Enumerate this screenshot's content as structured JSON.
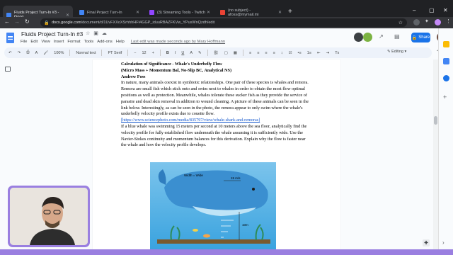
{
  "browser": {
    "tabs": [
      {
        "title": "Fluids Project Turn-In #3 - Goog",
        "favicon_color": "#4285f4",
        "active": true
      },
      {
        "title": "Final Project Turn-In",
        "favicon_color": "#4285f4",
        "active": false
      },
      {
        "title": "(3) Streaming Tools - Twitch",
        "favicon_color": "#9146ff",
        "active": false
      },
      {
        "title": "(no subject) - afoss@mymail.mi",
        "favicon_color": "#ea4335",
        "active": false
      }
    ],
    "new_tab_glyph": "+",
    "window_controls": [
      "–",
      "▢",
      "✕"
    ],
    "url_host": "docs.google.com",
    "url_path": "/document/d/1UvFXXoXSrhhhHFt4GGP_iduuRBAZFKVw_YPuxWnQzdh/edit"
  },
  "docs": {
    "title": "Fluids Project Turn-In #3",
    "menu": [
      "File",
      "Edit",
      "View",
      "Insert",
      "Format",
      "Tools",
      "Add-ons",
      "Help"
    ],
    "last_edit": "Last edit was made seconds ago by Mary Hoffmann",
    "share_label": "Share",
    "toolbar": {
      "zoom": "100%",
      "style": "Normal text",
      "font": "PT Serif",
      "size": "12",
      "mode": "Editing"
    }
  },
  "document": {
    "heading1": "Calculation of Significance - Whale's Underbelly Flow",
    "heading2": "(Micro Mass + Momentum Bal, No-Slip BC, Analytical NS)",
    "author": "Andrew Foss",
    "paragraph1": "In nature, many animals coexist in symbiotic relationships. One pair of these species is whales and remora. Remora are small fish which stick onto and swim next to whales in order to obtain the most flow optimal positions as well as protection. Meanwhile, whales tolerate these sucker fish as they provide the service of parasite and dead skin removal in addition to wound cleaning. A picture of these animals can be seen in the link below. Interestingly, as can be seen in the photo, the remora appear to only swim where the whale's underbelly velocity profile exists due to couette flow.",
    "link": "[https://www.sciencephoto.com/media/835797/view/whale-shark-and-remoras]",
    "paragraph2": "If a blue whale was swimming 15 meters per second at 10 meters above the sea floor, analytically find the velocity profile for fully established flow underneath the whale assuming it is sufficiently wide. Use the Navier-Stokes continuity and momentum balances for this derivation. Explain why the flow is faster near the whale and how the velocity profile develops.",
    "figure_labels": {
      "width": "Width = Wide",
      "speed": "15 m/s",
      "height": "10m"
    }
  },
  "colors": {
    "accent": "#1a73e8",
    "webcam_border": "#9a7fe0",
    "link": "#1155cc"
  }
}
